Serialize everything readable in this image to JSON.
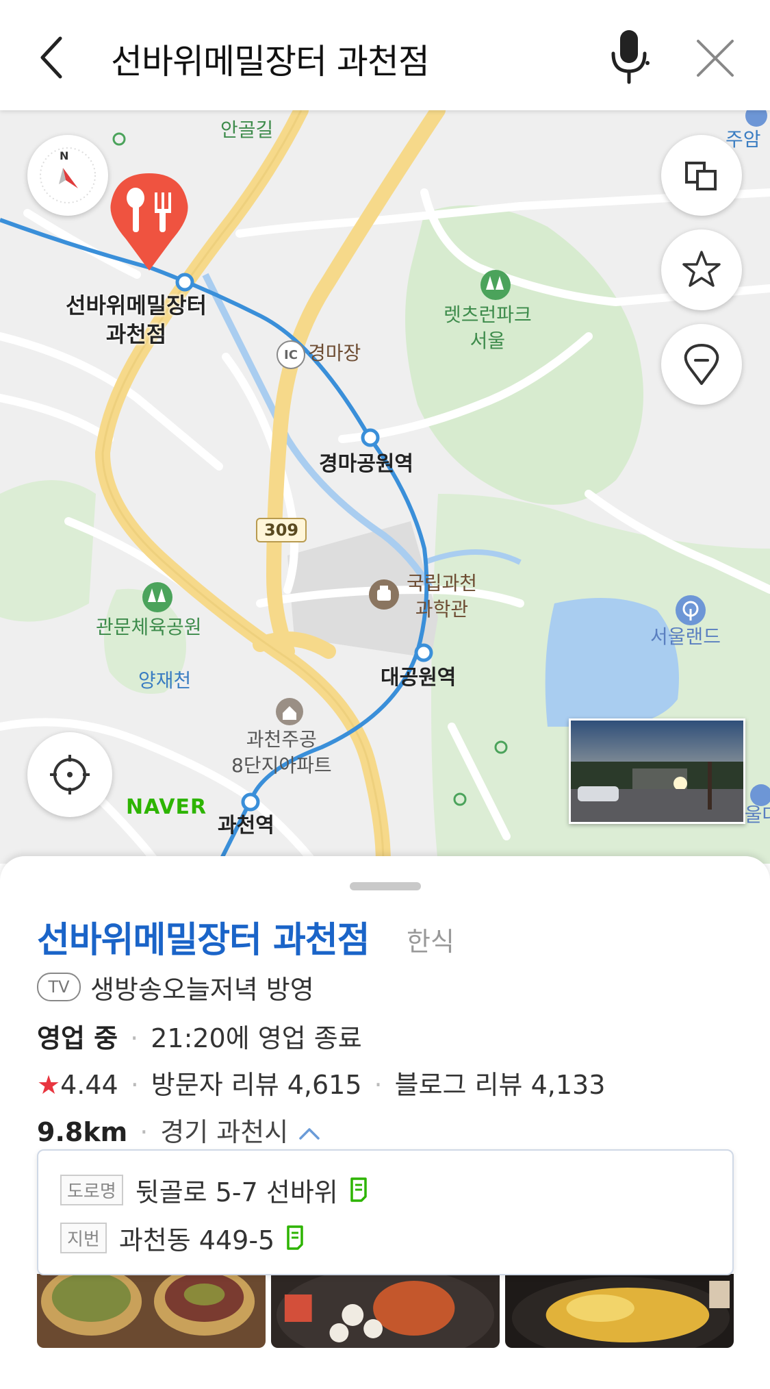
{
  "search": {
    "query": "선바위메밀장터 과천점",
    "icons": {
      "back": "chevron-left-icon",
      "mic": "microphone-icon",
      "close": "close-icon"
    }
  },
  "map": {
    "labels": {
      "angolgil": "안골길",
      "jooam": "주암",
      "lets_run_park": "렛츠런파크\n서울",
      "gyeongmajang": "경마장",
      "gyeongma_station": "경마공원역",
      "route309": "309",
      "science_museum": "국립과천\n과학관",
      "seoul_land": "서울랜드",
      "gwanmun_park": "관문체육공원",
      "yangjaecheon": "양재천",
      "daegongwon_station": "대공원역",
      "apartment": "과천주공\n8단지아파트",
      "gwacheon_station": "과천역",
      "seoul_edge": "서울대",
      "ic": "IC"
    },
    "pin_label": "선바위메밀장터\n과천점",
    "naver_logo": "NAVER",
    "buttons": [
      "compass-icon",
      "layers-icon",
      "star-icon",
      "pin-icon",
      "locate-icon"
    ]
  },
  "place": {
    "name": "선바위메밀장터 과천점",
    "category": "한식",
    "tv_badge": "TV",
    "tv_text": "생방송오늘저녁 방영",
    "status": "영업 중",
    "hours": "21:20에 영업 종료",
    "rating": "4.44",
    "visitor_reviews": "방문자 리뷰 4,615",
    "blog_reviews": "블로그 리뷰 4,133",
    "distance": "9.8km",
    "region": "경기 과천시",
    "address": {
      "road_tag": "도로명",
      "road": "뒷골로 5-7 선바위",
      "lot_tag": "지번",
      "lot": "과천동 449-5"
    }
  },
  "colors": {
    "accent_blue": "#1a64c8",
    "naver_green": "#2db400",
    "pin_red": "#ef5340",
    "star_red": "#e8353f",
    "copy_green": "#2db400"
  }
}
